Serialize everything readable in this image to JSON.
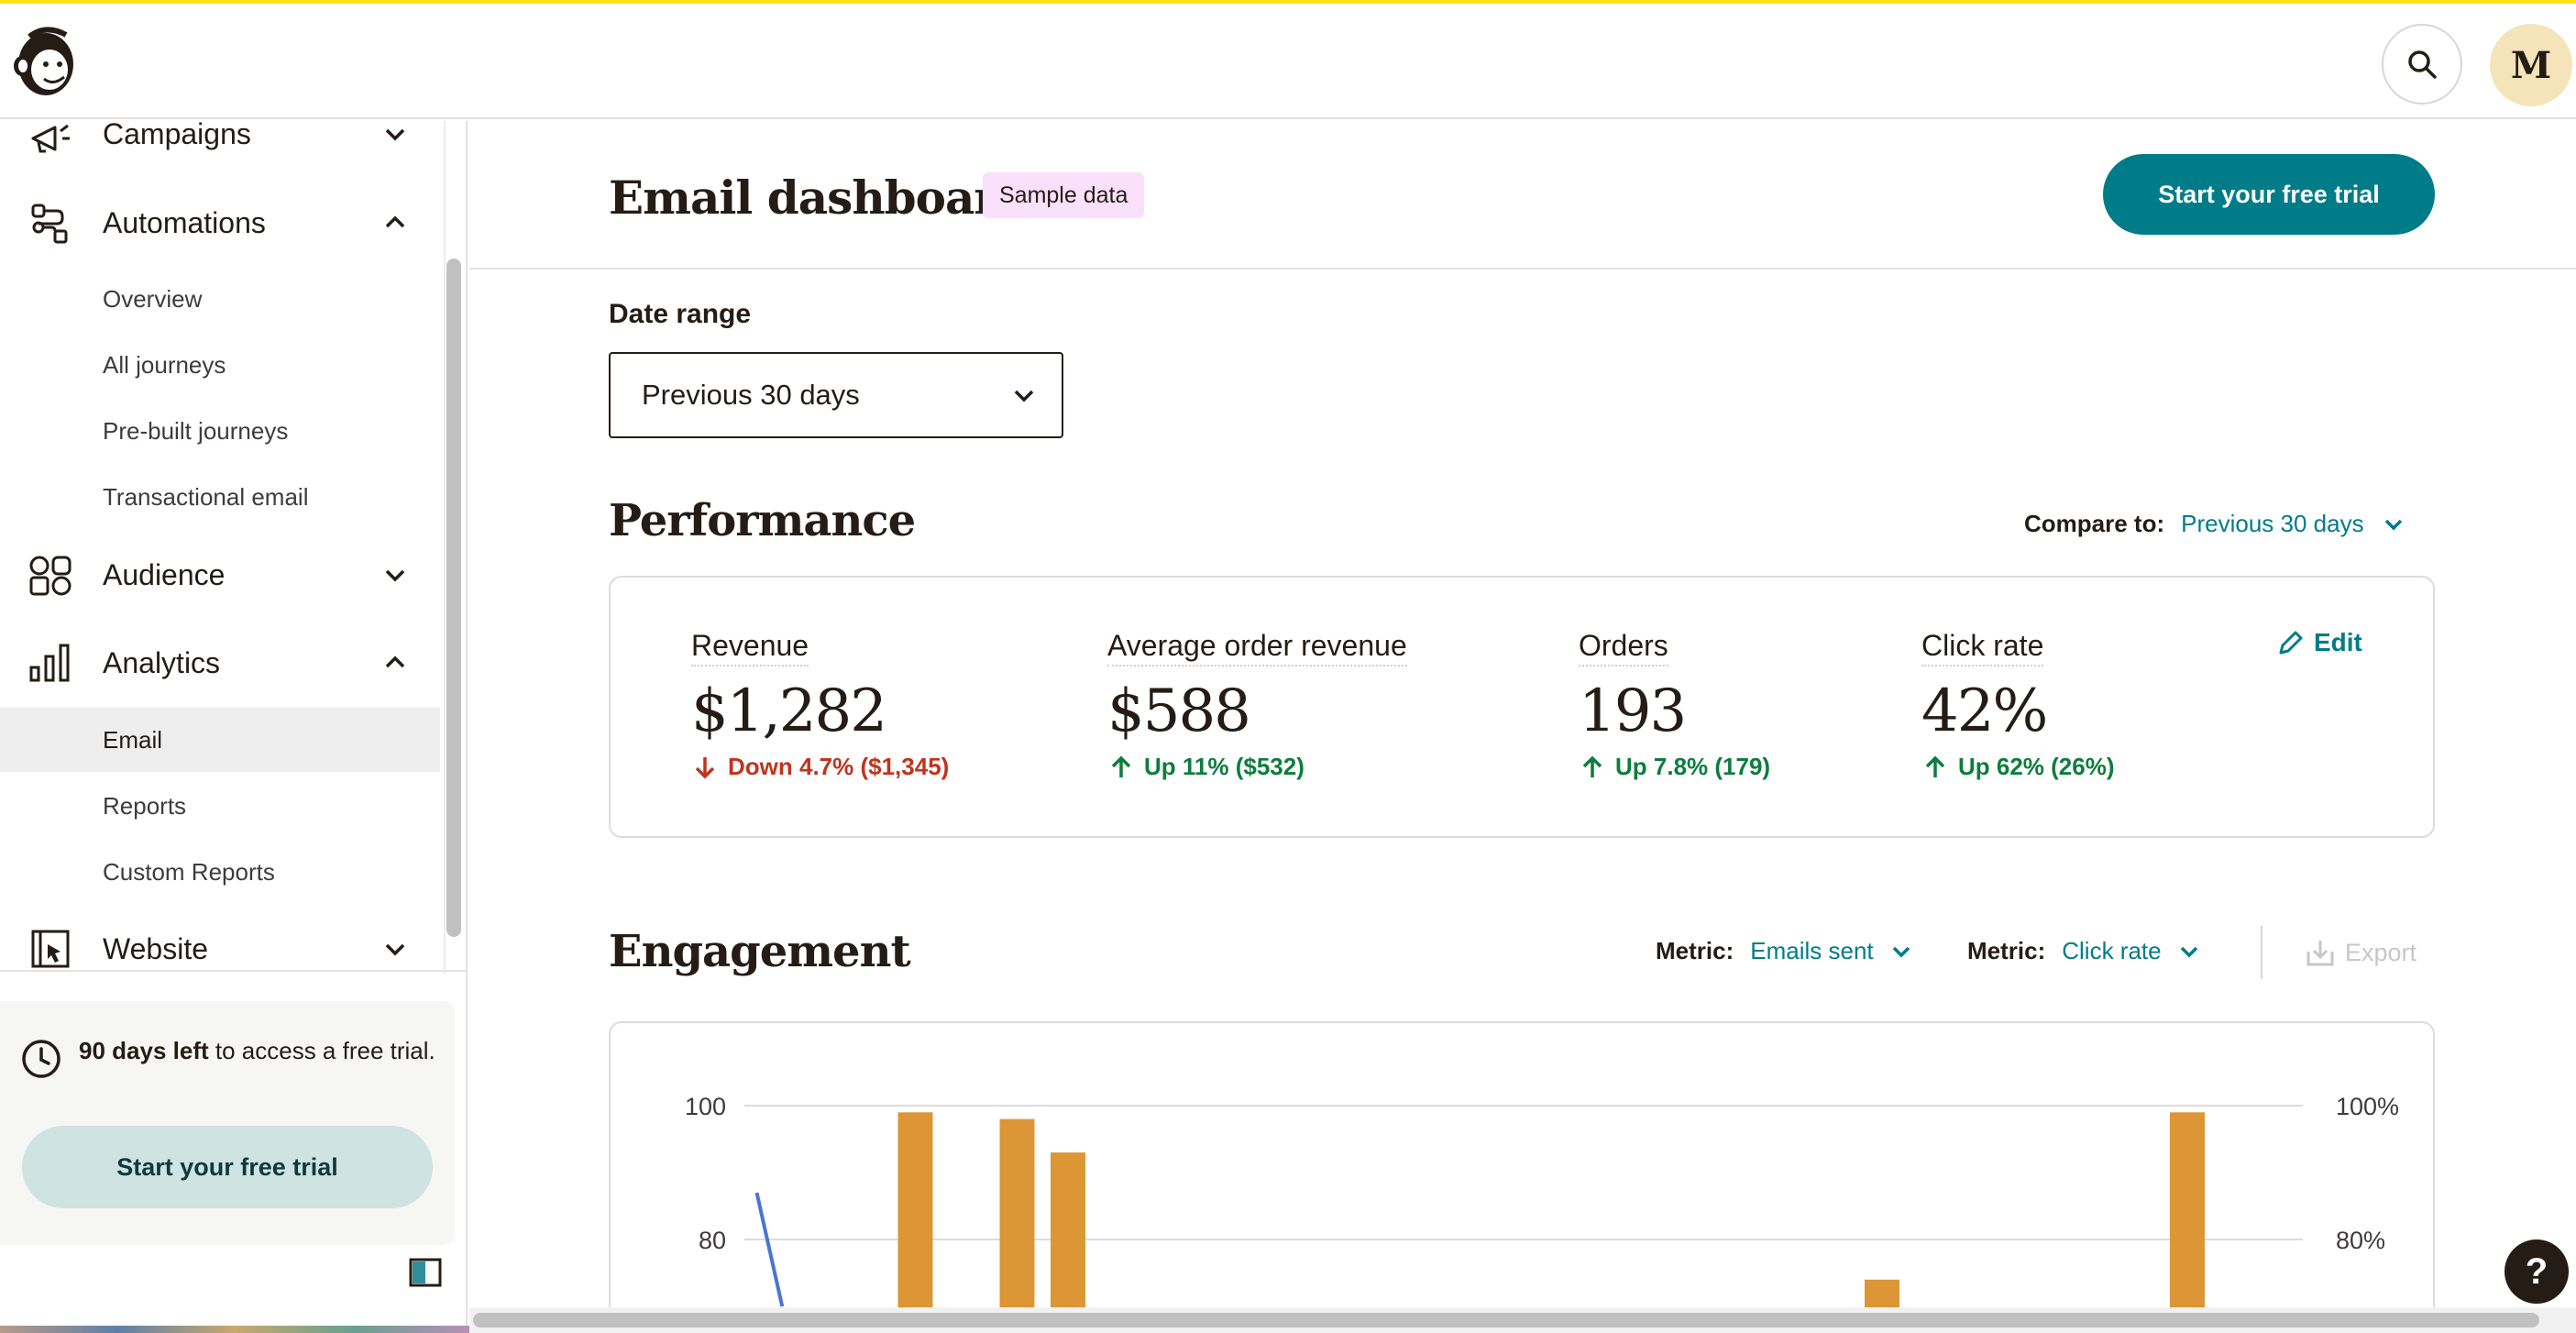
{
  "header": {
    "avatar_letter": "M"
  },
  "sidebar": {
    "items": [
      {
        "label": "Campaigns",
        "icon": "megaphone-icon",
        "expanded": false
      },
      {
        "label": "Automations",
        "icon": "automation-flow-icon",
        "expanded": true,
        "children": [
          "Overview",
          "All journeys",
          "Pre-built journeys",
          "Transactional email"
        ]
      },
      {
        "label": "Audience",
        "icon": "audience-icon",
        "expanded": false
      },
      {
        "label": "Analytics",
        "icon": "bar-chart-icon",
        "expanded": true,
        "children": [
          "Email",
          "Reports",
          "Custom Reports"
        ],
        "active_child": "Email"
      },
      {
        "label": "Website",
        "icon": "website-cursor-icon",
        "expanded": false
      }
    ],
    "trial": {
      "days_left": "90 days left",
      "rest": " to access a free trial.",
      "button": "Start your free trial"
    }
  },
  "main": {
    "title": "Email dashboard",
    "badge": "Sample data",
    "cta": "Start your free trial",
    "date_range": {
      "label": "Date range",
      "value": "Previous 30 days"
    },
    "performance": {
      "title": "Performance",
      "compare_label": "Compare to:",
      "compare_value": "Previous 30 days",
      "edit": "Edit",
      "metrics": [
        {
          "name": "Revenue",
          "value": "$1,282",
          "delta": "Down 4.7% ($1,345)",
          "direction": "down"
        },
        {
          "name": "Average order revenue",
          "value": "$588",
          "delta": "Up 11% ($532)",
          "direction": "up"
        },
        {
          "name": "Orders",
          "value": "193",
          "delta": "Up 7.8% (179)",
          "direction": "up"
        },
        {
          "name": "Click rate",
          "value": "42%",
          "delta": "Up 62% (26%)",
          "direction": "up"
        }
      ]
    },
    "engagement": {
      "title": "Engagement",
      "metric1_label": "Metric:",
      "metric1_value": "Emails sent",
      "metric2_label": "Metric:",
      "metric2_value": "Click rate",
      "export": "Export"
    }
  },
  "chart_data": {
    "type": "bar",
    "left_axis_ticks": [
      "100",
      "80"
    ],
    "right_axis_ticks": [
      "100%",
      "80%"
    ],
    "left_ylim": [
      0,
      100
    ],
    "series": [
      {
        "name": "Emails sent",
        "type": "bar",
        "color": "#dd9636",
        "points": [
          {
            "slot": 3,
            "value": 99
          },
          {
            "slot": 5,
            "value": 98
          },
          {
            "slot": 6,
            "value": 93
          },
          {
            "slot": 22,
            "value": 74
          },
          {
            "slot": 28,
            "value": 99
          }
        ]
      },
      {
        "name": "Click rate",
        "type": "line",
        "color": "#4a74d8",
        "points": [
          {
            "slot": 1,
            "value": 87
          },
          {
            "slot": 1.5,
            "value": 70
          }
        ]
      }
    ]
  },
  "help": {
    "label": "?"
  },
  "colors": {
    "brand": "#007c89",
    "down": "#c0341d",
    "up": "#0c7d3c",
    "bar": "#dd9636",
    "line": "#4a74d8",
    "badge": "#fbe0fb"
  }
}
